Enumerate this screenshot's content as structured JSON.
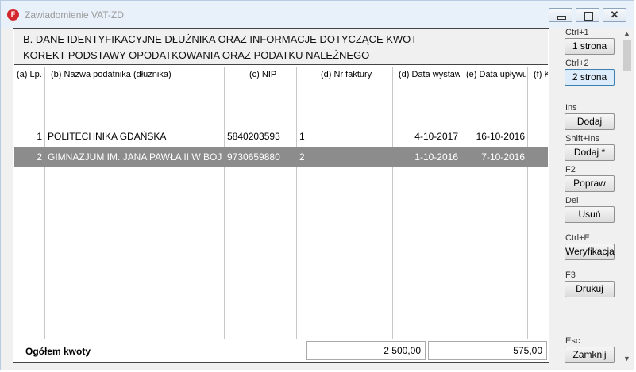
{
  "window": {
    "title": "Zawiadomienie VAT-ZD",
    "app_icon_letter": "F",
    "minimize": "minimize-icon",
    "maximize": "maximize-icon",
    "close": "✕"
  },
  "section_header": {
    "line1": "B. DANE IDENTYFIKACYJNE DŁUŻNIKA ORAZ INFORMACJE DOTYCZĄCE KWOT",
    "line2": "KOREKT PODSTAWY OPODATKOWANIA ORAZ PODATKU NALEŻNEGO"
  },
  "table": {
    "columns": [
      "(a) Lp.",
      "(b) Nazwa podatnika (dłużnika)",
      "(c) NIP",
      "(d) Nr faktury",
      "(d) Data wystaw",
      "(e) Data upływu",
      "(f) K"
    ],
    "rows": [
      {
        "lp": "1",
        "name": "POLITECHNIKA GDAŃSKA",
        "nip": "5840203593",
        "invoice": "1",
        "issue_date": "4-10-2017",
        "due_date": "16-10-2016",
        "selected": false
      },
      {
        "lp": "2",
        "name": "GIMNAZJUM IM. JANA PAWŁA II W BOJADŁ",
        "nip": "9730659880",
        "invoice": "2",
        "issue_date": "1-10-2016",
        "due_date": "7-10-2016",
        "selected": true
      }
    ]
  },
  "footer": {
    "label": "Ogółem kwoty",
    "total1": "2 500,00",
    "total2": "575,00"
  },
  "sidebar": {
    "page1": {
      "key": "Ctrl+1",
      "label": "1 strona"
    },
    "page2": {
      "key": "Ctrl+2",
      "label": "2 strona"
    },
    "add": {
      "key": "Ins",
      "label": "Dodaj"
    },
    "add_copy": {
      "key": "Shift+Ins",
      "label": "Dodaj *"
    },
    "edit": {
      "key": "F2",
      "label": "Popraw"
    },
    "delete": {
      "key": "Del",
      "label": "Usuń"
    },
    "verify": {
      "key": "Ctrl+E",
      "label": "Weryfikacja"
    },
    "print": {
      "key": "F3",
      "label": "Drukuj"
    },
    "close": {
      "key": "Esc",
      "label": "Zamknij"
    }
  },
  "colors": {
    "selected_row": "#8c8c8c",
    "active_button": "#dcecfa",
    "app_icon": "#d4262d"
  }
}
